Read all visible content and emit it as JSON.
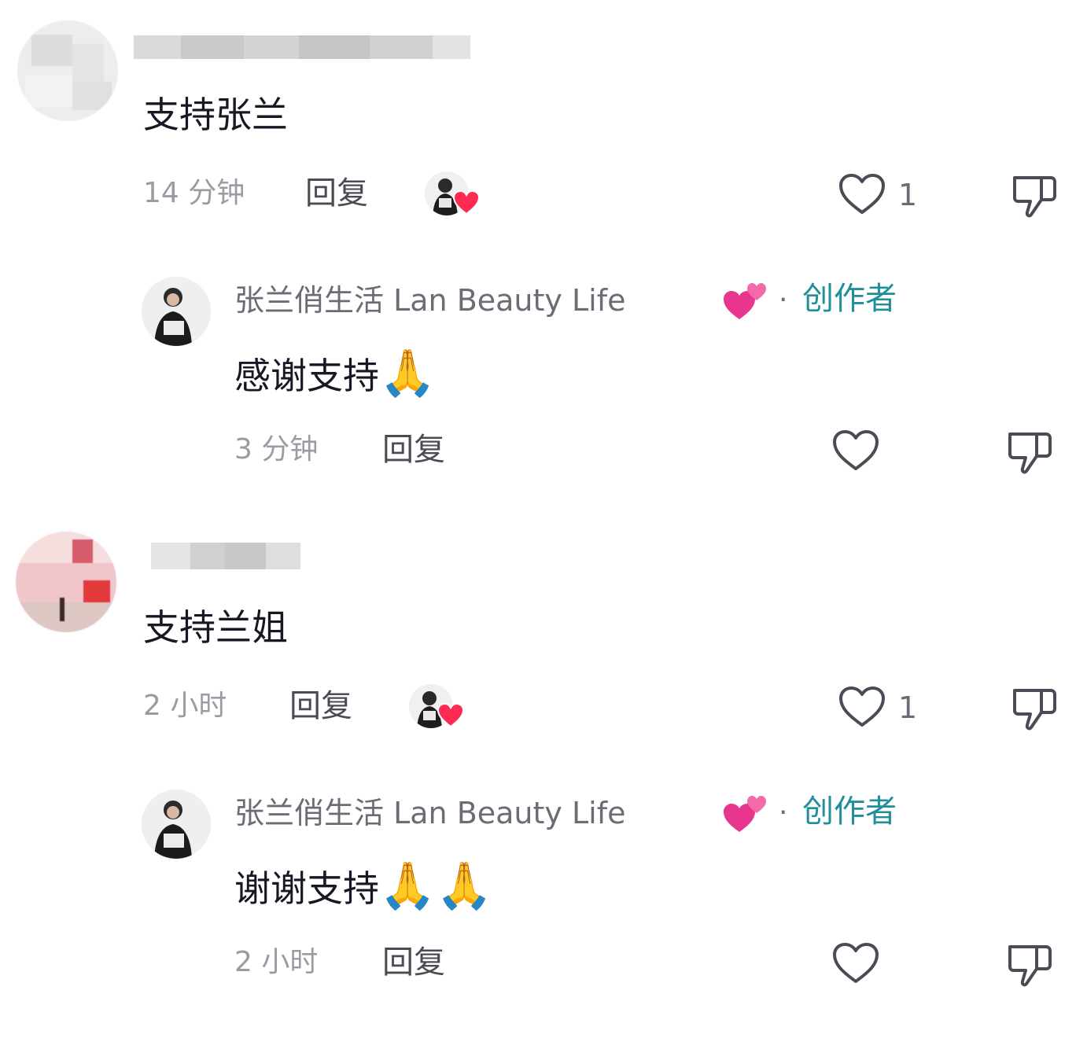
{
  "comments": [
    {
      "text": "支持张兰",
      "time": "14 分钟",
      "reply_label": "回复",
      "like_count": "1",
      "reply": {
        "author": "张兰俏生活 Lan Beauty Life",
        "separator": "·",
        "tag": "创作者",
        "text": "感谢支持",
        "emoji": "🙏",
        "time": "3 分钟",
        "reply_label": "回复"
      }
    },
    {
      "text": "支持兰姐",
      "time": "2 小时",
      "reply_label": "回复",
      "like_count": "1",
      "reply": {
        "author": "张兰俏生活 Lan Beauty Life",
        "separator": "·",
        "tag": "创作者",
        "text": "谢谢支持",
        "emoji": "🙏🙏",
        "time": "2 小时",
        "reply_label": "回复"
      }
    }
  ],
  "colors": {
    "creator_tag": "#1f8f9a",
    "liked_heart": "#fe2c55",
    "muted_text": "#9b9ca3"
  },
  "icons": [
    "heart-outline-icon",
    "thumbs-down-icon",
    "liked-by-creator-heart-icon",
    "sparkling-hearts-emoji-icon",
    "praying-hands-emoji-icon"
  ]
}
